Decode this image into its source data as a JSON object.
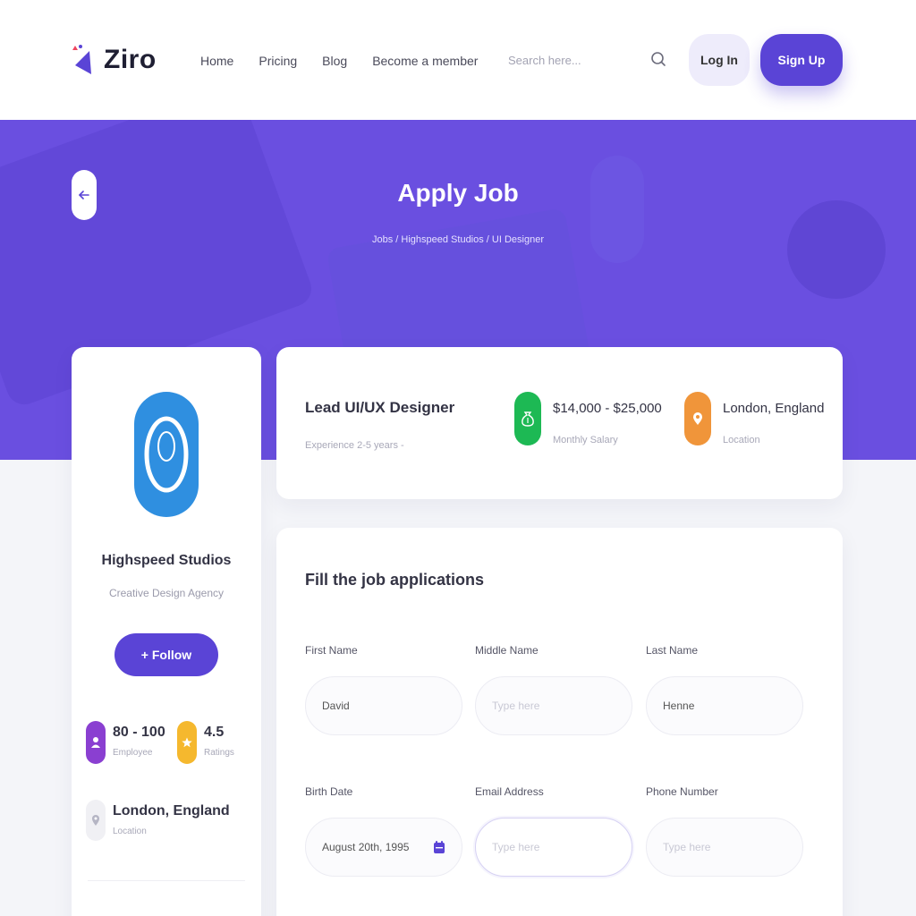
{
  "brand": {
    "name": "Ziro",
    "accent": "#5a44d6",
    "hero_bg": "#6a4fe0"
  },
  "nav": {
    "items": [
      "Home",
      "Pricing",
      "Blog",
      "Become a member"
    ]
  },
  "search": {
    "placeholder": "Search here...",
    "icon": "search-icon"
  },
  "header": {
    "login_label": "Log In",
    "signup_label": "Sign Up"
  },
  "hero": {
    "title": "Apply Job",
    "breadcrumb": "Jobs / Highspeed Studios / UI Designer",
    "back_icon": "arrow-left-icon"
  },
  "company": {
    "name": "Highspeed Studios",
    "subtitle": "Creative Design Agency",
    "follow_label": "+ Follow",
    "stats": [
      {
        "value": "80 - 100",
        "label": "Employee",
        "color": "#8a3fd1",
        "icon": "user-icon"
      },
      {
        "value": "4.5",
        "label": "Ratings",
        "color": "#f5b82e",
        "icon": "star-icon"
      }
    ],
    "location": {
      "value": "London, England",
      "label": "Location",
      "icon": "map-pin-icon"
    }
  },
  "job": {
    "title": "Lead UI/UX Designer",
    "experience": "Experience 2-5 years -",
    "salary": {
      "value": "$14,000 - $25,000",
      "label": "Monthly Salary",
      "color": "#1db954",
      "icon": "money-bag-icon"
    },
    "location": {
      "value": "London, England",
      "label": "Location",
      "color": "#f0953a",
      "icon": "map-pin-icon"
    }
  },
  "form": {
    "title": "Fill the job applications",
    "fields": [
      {
        "label": "First Name",
        "value": "David",
        "placeholder": ""
      },
      {
        "label": "Middle Name",
        "value": "",
        "placeholder": "Type here"
      },
      {
        "label": "Last Name",
        "value": "Henne",
        "placeholder": ""
      },
      {
        "label": "Birth Date",
        "value": "August 20th, 1995",
        "placeholder": "",
        "icon": "calendar-icon"
      },
      {
        "label": "Email Address",
        "value": "",
        "placeholder": "Type here"
      },
      {
        "label": "Phone Number",
        "value": "",
        "placeholder": "Type here"
      }
    ]
  }
}
